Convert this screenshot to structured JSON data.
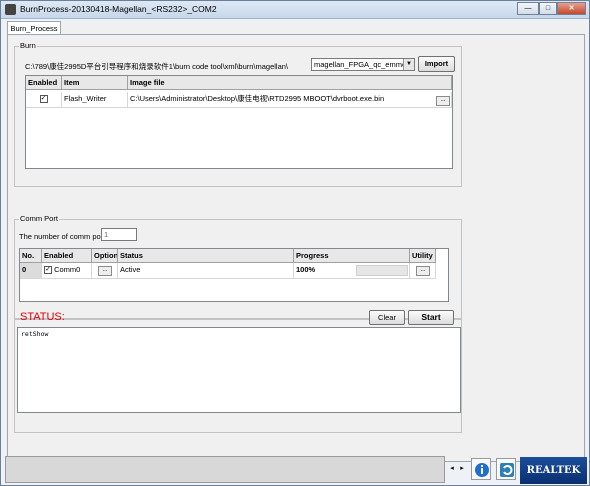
{
  "window": {
    "title": "BurnProcess-20130418-Magellan_<RS232>_COM2",
    "min": "—",
    "max": "□",
    "close": "✕"
  },
  "tabs": [
    {
      "label": "Burn_Process"
    }
  ],
  "burn": {
    "group_label": "Burn",
    "path": "C:\\789\\康佳2995D平台引导程序和烧录软件1\\burn code tool\\xml\\burn\\magellan\\",
    "combo_value": "magellan_FPGA_qc_emmc",
    "import_label": "Import",
    "columns": [
      "Enabled",
      "Item",
      "Image file"
    ],
    "rows": [
      {
        "enabled": "✓",
        "item": "Flash_Writer",
        "image_file": "C:\\Users\\Administrator\\Desktop\\康佳电视\\RTD2995 MBOOT\\dvrboot.exe.bin",
        "browse": "..."
      }
    ]
  },
  "comm": {
    "group_label": "Comm Port",
    "count_label": "The number of comm port",
    "count_value": "1",
    "columns": [
      "No.",
      "Enabled",
      "Option",
      "Status",
      "Progress",
      "Utility"
    ],
    "rows": [
      {
        "no": "0",
        "enabled": "✓",
        "name": "Comm0",
        "option": "...",
        "status": "Active",
        "progress": "100%",
        "utility": "..."
      }
    ]
  },
  "status": {
    "title": "STATUS:",
    "clear_label": "Clear",
    "start_label": "Start",
    "log": "retShow"
  },
  "footer": {
    "prev": "◂",
    "next": "▸",
    "brand": "REALTEK"
  },
  "colors": {
    "status_red": "#e00000",
    "brand_blue": "#1b4e9b"
  }
}
